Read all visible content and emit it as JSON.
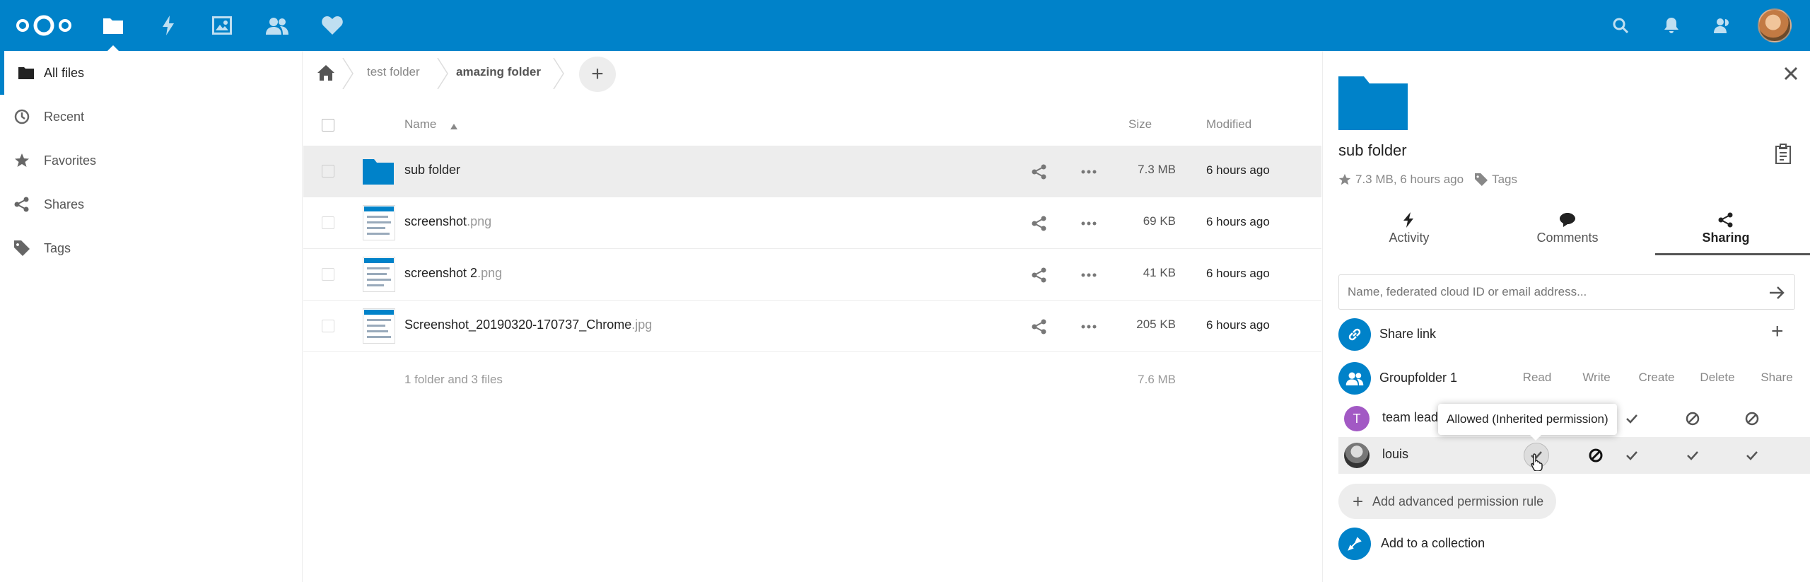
{
  "colors": {
    "primary": "#0082c9",
    "header_bg": "#0082c9",
    "selected_row": "#ededed",
    "team_lead_avatar": "#a259c4"
  },
  "header": {
    "apps": [
      "files-icon",
      "activity-icon",
      "gallery-icon",
      "contacts-icon",
      "favorites-icon"
    ],
    "right_icons": [
      "search-icon",
      "notifications-icon",
      "contacts-menu-icon",
      "user-avatar"
    ]
  },
  "sidebar_nav": {
    "items": [
      {
        "label": "All files",
        "icon": "folder-icon"
      },
      {
        "label": "Recent",
        "icon": "clock-icon"
      },
      {
        "label": "Favorites",
        "icon": "star-icon"
      },
      {
        "label": "Shares",
        "icon": "share-icon"
      },
      {
        "label": "Tags",
        "icon": "tag-icon"
      }
    ]
  },
  "breadcrumbs": {
    "items": [
      "test folder",
      "amazing folder"
    ],
    "add_label": "+"
  },
  "table": {
    "headers": {
      "name": "Name",
      "size": "Size",
      "modified": "Modified"
    },
    "rows": [
      {
        "name": "sub folder",
        "ext": "",
        "size": "7.3 MB",
        "modified": "6 hours ago"
      },
      {
        "name": "screenshot",
        "ext": ".png",
        "size": "69 KB",
        "modified": "6 hours ago"
      },
      {
        "name": "screenshot 2",
        "ext": ".png",
        "size": "41 KB",
        "modified": "6 hours ago"
      },
      {
        "name": "Screenshot_20190320-170737_Chrome",
        "ext": ".jpg",
        "size": "205 KB",
        "modified": "6 hours ago"
      }
    ],
    "summary": {
      "text": "1 folder and 3 files",
      "size": "7.6 MB"
    }
  },
  "details": {
    "title": "sub folder",
    "meta": "7.3 MB, 6 hours ago",
    "tags_label": "Tags",
    "tabs": [
      "Activity",
      "Comments",
      "Sharing"
    ],
    "share_placeholder": "Name, federated cloud ID or email address...",
    "share_link_label": "Share link",
    "groupfolder_label": "Groupfolder 1",
    "perm_headers": [
      "Read",
      "Write",
      "Create",
      "Delete",
      "Share"
    ],
    "users": [
      {
        "name": "team lead",
        "initial": "T"
      },
      {
        "name": "louis"
      }
    ],
    "tooltip": "Allowed (Inherited permission)",
    "advanced_rule_label": "Add advanced permission rule",
    "collection_label": "Add to a collection"
  }
}
